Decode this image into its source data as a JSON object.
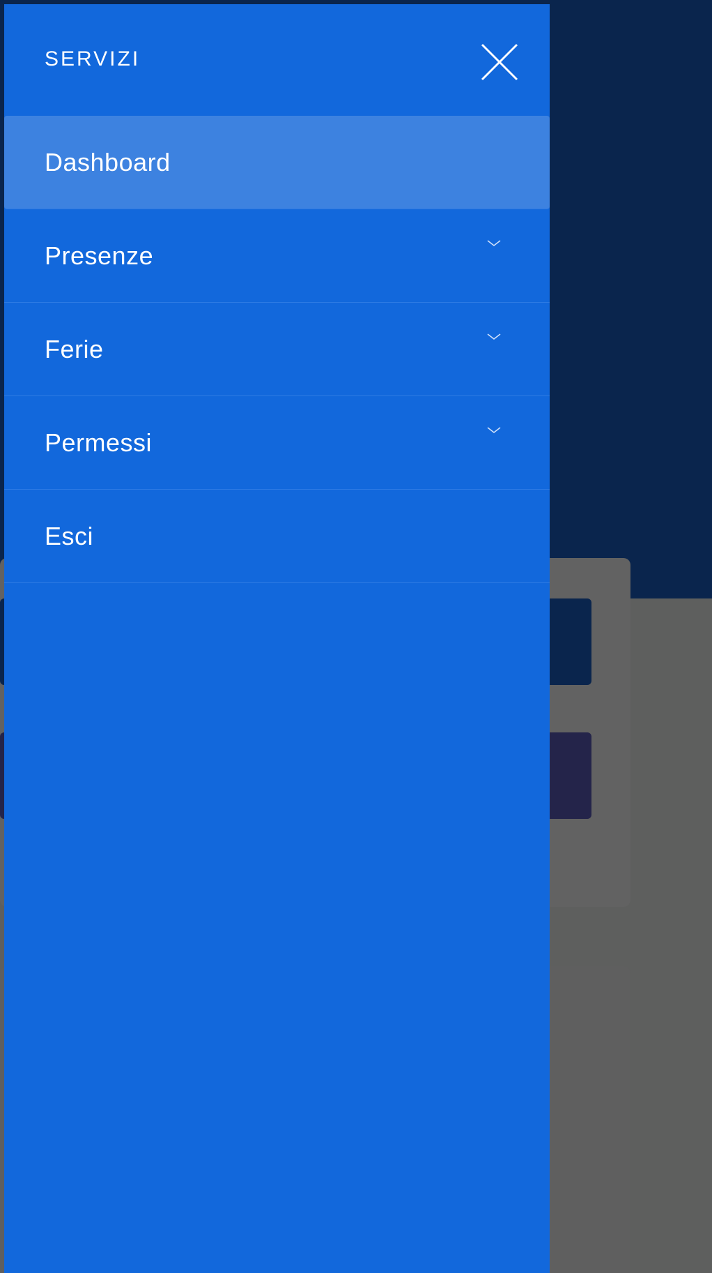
{
  "drawer": {
    "title": "SERVIZI",
    "close_icon": "close-icon",
    "items": [
      {
        "label": "Dashboard",
        "active": true,
        "expandable": false
      },
      {
        "label": "Presenze",
        "active": false,
        "expandable": true
      },
      {
        "label": "Ferie",
        "active": false,
        "expandable": true
      },
      {
        "label": "Permessi",
        "active": false,
        "expandable": true
      },
      {
        "label": "Esci",
        "active": false,
        "expandable": false
      }
    ]
  },
  "colors": {
    "drawer_bg": "#1268dc",
    "active_item_bg": "#3d82e0",
    "page_header_bg": "#0a254d",
    "overlay": "#5e5f5e"
  }
}
